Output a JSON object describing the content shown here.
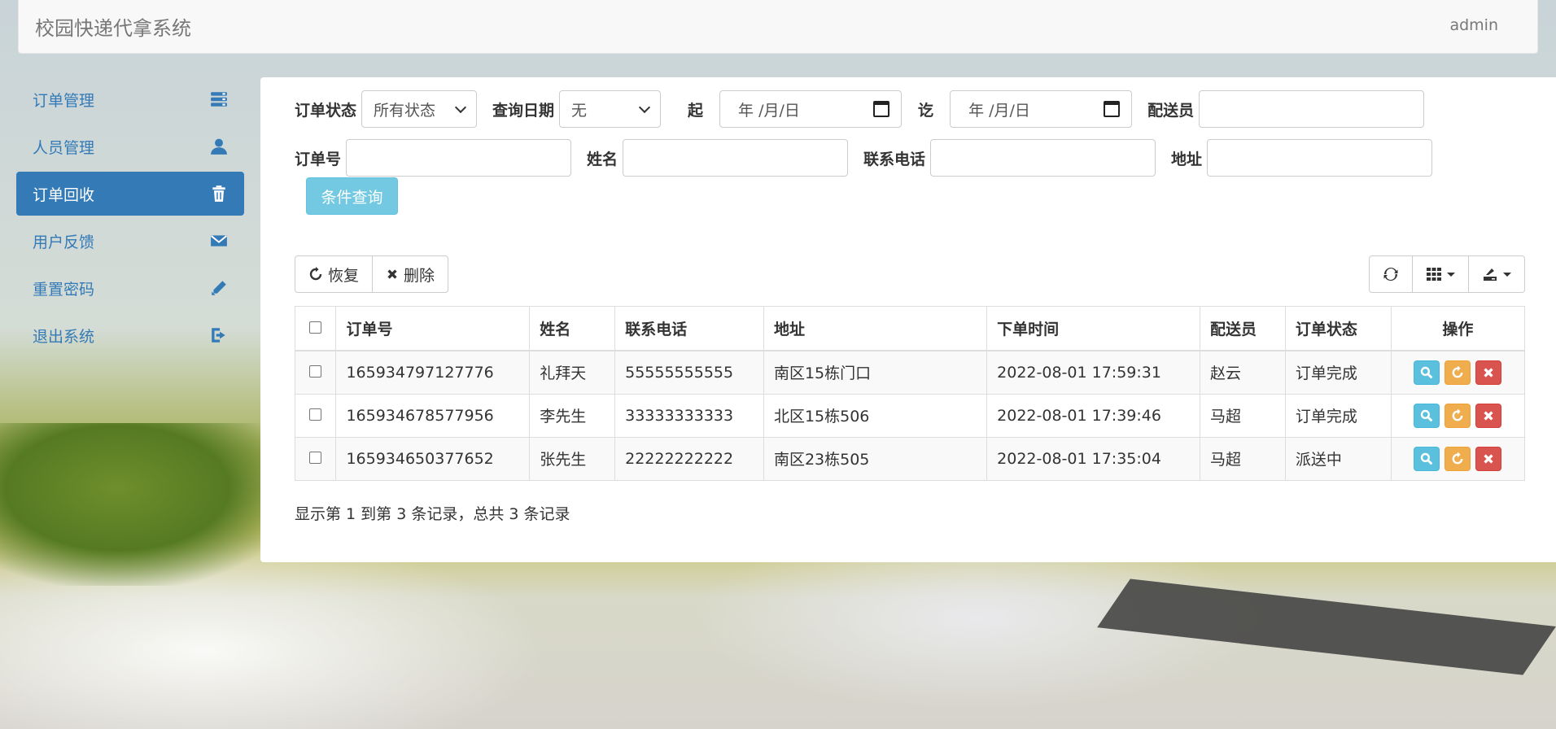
{
  "header": {
    "brand": "校园快递代拿系统",
    "user": "admin"
  },
  "sidebar": {
    "items": [
      {
        "label": "订单管理",
        "icon": "tasks-icon"
      },
      {
        "label": "人员管理",
        "icon": "user-icon"
      },
      {
        "label": "订单回收",
        "icon": "trash-icon",
        "active": true
      },
      {
        "label": "用户反馈",
        "icon": "envelope-icon"
      },
      {
        "label": "重置密码",
        "icon": "pencil-icon"
      },
      {
        "label": "退出系统",
        "icon": "logout-icon"
      }
    ]
  },
  "filters": {
    "order_status_label": "订单状态",
    "order_status_value": "所有状态",
    "query_date_label": "查询日期",
    "query_date_value": "无",
    "start_label": "起",
    "start_placeholder": "年 /月/日",
    "end_label": "讫",
    "end_placeholder": "年 /月/日",
    "courier_label": "配送员",
    "order_no_label": "订单号",
    "name_label": "姓名",
    "phone_label": "联系电话",
    "address_label": "地址",
    "query_button": "条件查询"
  },
  "toolbar": {
    "restore": "恢复",
    "delete": "删除"
  },
  "table": {
    "columns": [
      "订单号",
      "姓名",
      "联系电话",
      "地址",
      "下单时间",
      "配送员",
      "订单状态",
      "操作"
    ],
    "rows": [
      [
        "165934797127776",
        "礼拜天",
        "55555555555",
        "南区15栋门口",
        "2022-08-01 17:59:31",
        "赵云",
        "订单完成"
      ],
      [
        "165934678577956",
        "李先生",
        "33333333333",
        "北区15栋506",
        "2022-08-01 17:39:46",
        "马超",
        "订单完成"
      ],
      [
        "165934650377652",
        "张先生",
        "22222222222",
        "南区23栋505",
        "2022-08-01 17:35:04",
        "马超",
        "派送中"
      ]
    ]
  },
  "summary": "显示第 1 到第 3 条记录，总共 3 条记录",
  "colors": {
    "primary": "#337ab7",
    "info": "#5bc0de",
    "warning": "#f0ad4e",
    "danger": "#d9534f"
  }
}
